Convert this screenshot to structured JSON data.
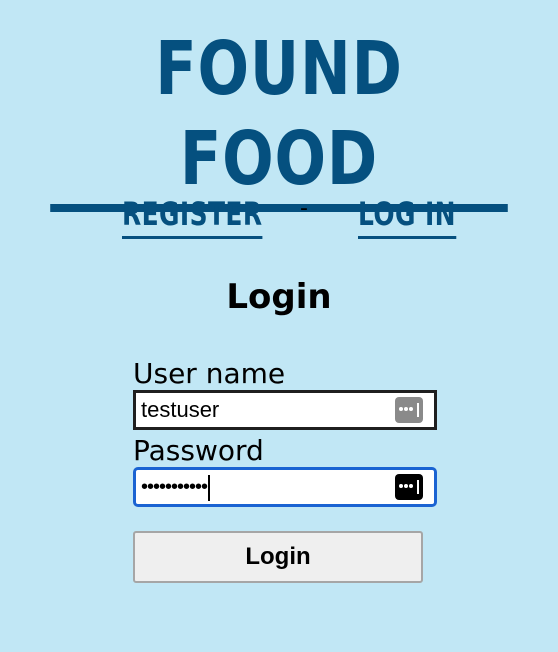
{
  "site": {
    "title": "FOUND FOOD"
  },
  "nav": {
    "register_label": "REGISTER",
    "separator": "-",
    "login_label": "LOG IN"
  },
  "form": {
    "heading": "Login",
    "username": {
      "label": "User name",
      "value": "testuser",
      "autofill_icon": "password-manager-icon"
    },
    "password": {
      "label": "Password",
      "masked_value": "•••••••••••",
      "autofill_icon": "password-manager-icon",
      "focused": true
    },
    "submit_label": "Login"
  },
  "colors": {
    "background": "#c1e7f5",
    "brand": "#05507f",
    "focus_ring": "#1a63d2"
  }
}
